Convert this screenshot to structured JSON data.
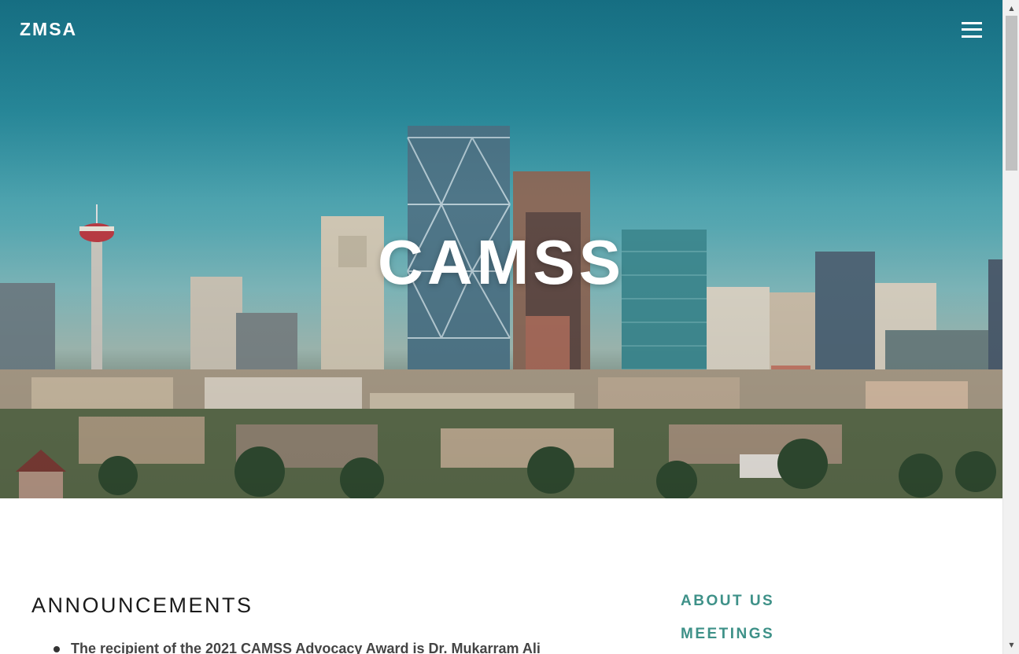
{
  "header": {
    "logo": "ZMSA",
    "menu_icon": "hamburger-menu-icon"
  },
  "hero": {
    "title": "CAMSS"
  },
  "announcements": {
    "heading": "ANNOUNCEMENTS",
    "items": [
      "The recipient of the 2021 CAMSS Advocacy Award is Dr. Mukarram Ali"
    ]
  },
  "side_nav": {
    "items": [
      "ABOUT US",
      "MEETINGS"
    ]
  },
  "colors": {
    "accent": "#3e9188",
    "sky_top": "#1a7f93",
    "text_dark": "#1a1a1a"
  },
  "scrollbar": {
    "up_icon": "scroll-up-arrow-icon",
    "down_icon": "scroll-down-arrow-icon"
  }
}
